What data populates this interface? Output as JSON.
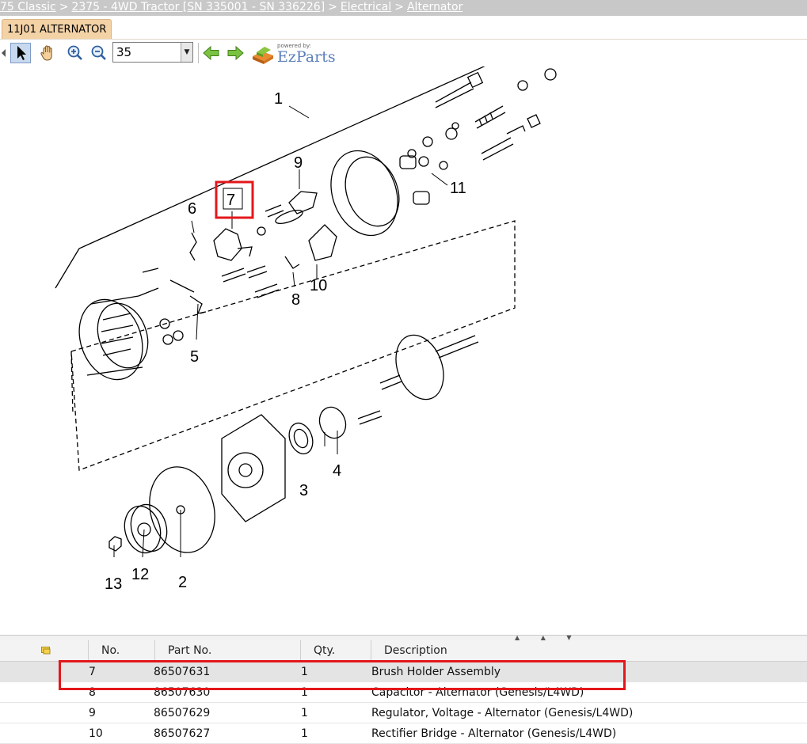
{
  "breadcrumb": {
    "items": [
      "75 Classic",
      "2375 - 4WD Tractor [SN 335001 - SN 336226]",
      "Electrical",
      "Alternator"
    ],
    "separator": ">"
  },
  "tabs": [
    {
      "label": "11J01 ALTERNATOR"
    }
  ],
  "toolbar": {
    "tools": [
      "arrow-pointer-icon",
      "hand-pan-icon",
      "zoom-in-icon",
      "zoom-out-icon"
    ],
    "zoom_value": "35",
    "nav": [
      "back-arrow-icon",
      "forward-arrow-icon"
    ],
    "brand_powered": "powered by:",
    "brand_name": "EzParts"
  },
  "diagram": {
    "callouts": [
      "1",
      "2",
      "3",
      "4",
      "5",
      "6",
      "7",
      "8",
      "9",
      "10",
      "11",
      "12",
      "13"
    ],
    "highlighted_callout": "7"
  },
  "parts_table": {
    "headers": [
      "No.",
      "Part No.",
      "Qty.",
      "Description"
    ],
    "rows": [
      {
        "no": "7",
        "part": "86507631",
        "qty": "1",
        "desc": "Brush Holder Assembly",
        "selected": true
      },
      {
        "no": "8",
        "part": "86507630",
        "qty": "1",
        "desc": "Capacitor - Alternator (Genesis/L4WD)"
      },
      {
        "no": "9",
        "part": "86507629",
        "qty": "1",
        "desc": "Regulator, Voltage - Alternator (Genesis/L4WD)"
      },
      {
        "no": "10",
        "part": "86507627",
        "qty": "1",
        "desc": "Rectifier Bridge - Alternator (Genesis/L4WD)"
      }
    ]
  },
  "colors": {
    "highlight": "#e3171b",
    "tab_bg": "#f3d2a6",
    "crumb_bg": "#c8c8c8"
  }
}
